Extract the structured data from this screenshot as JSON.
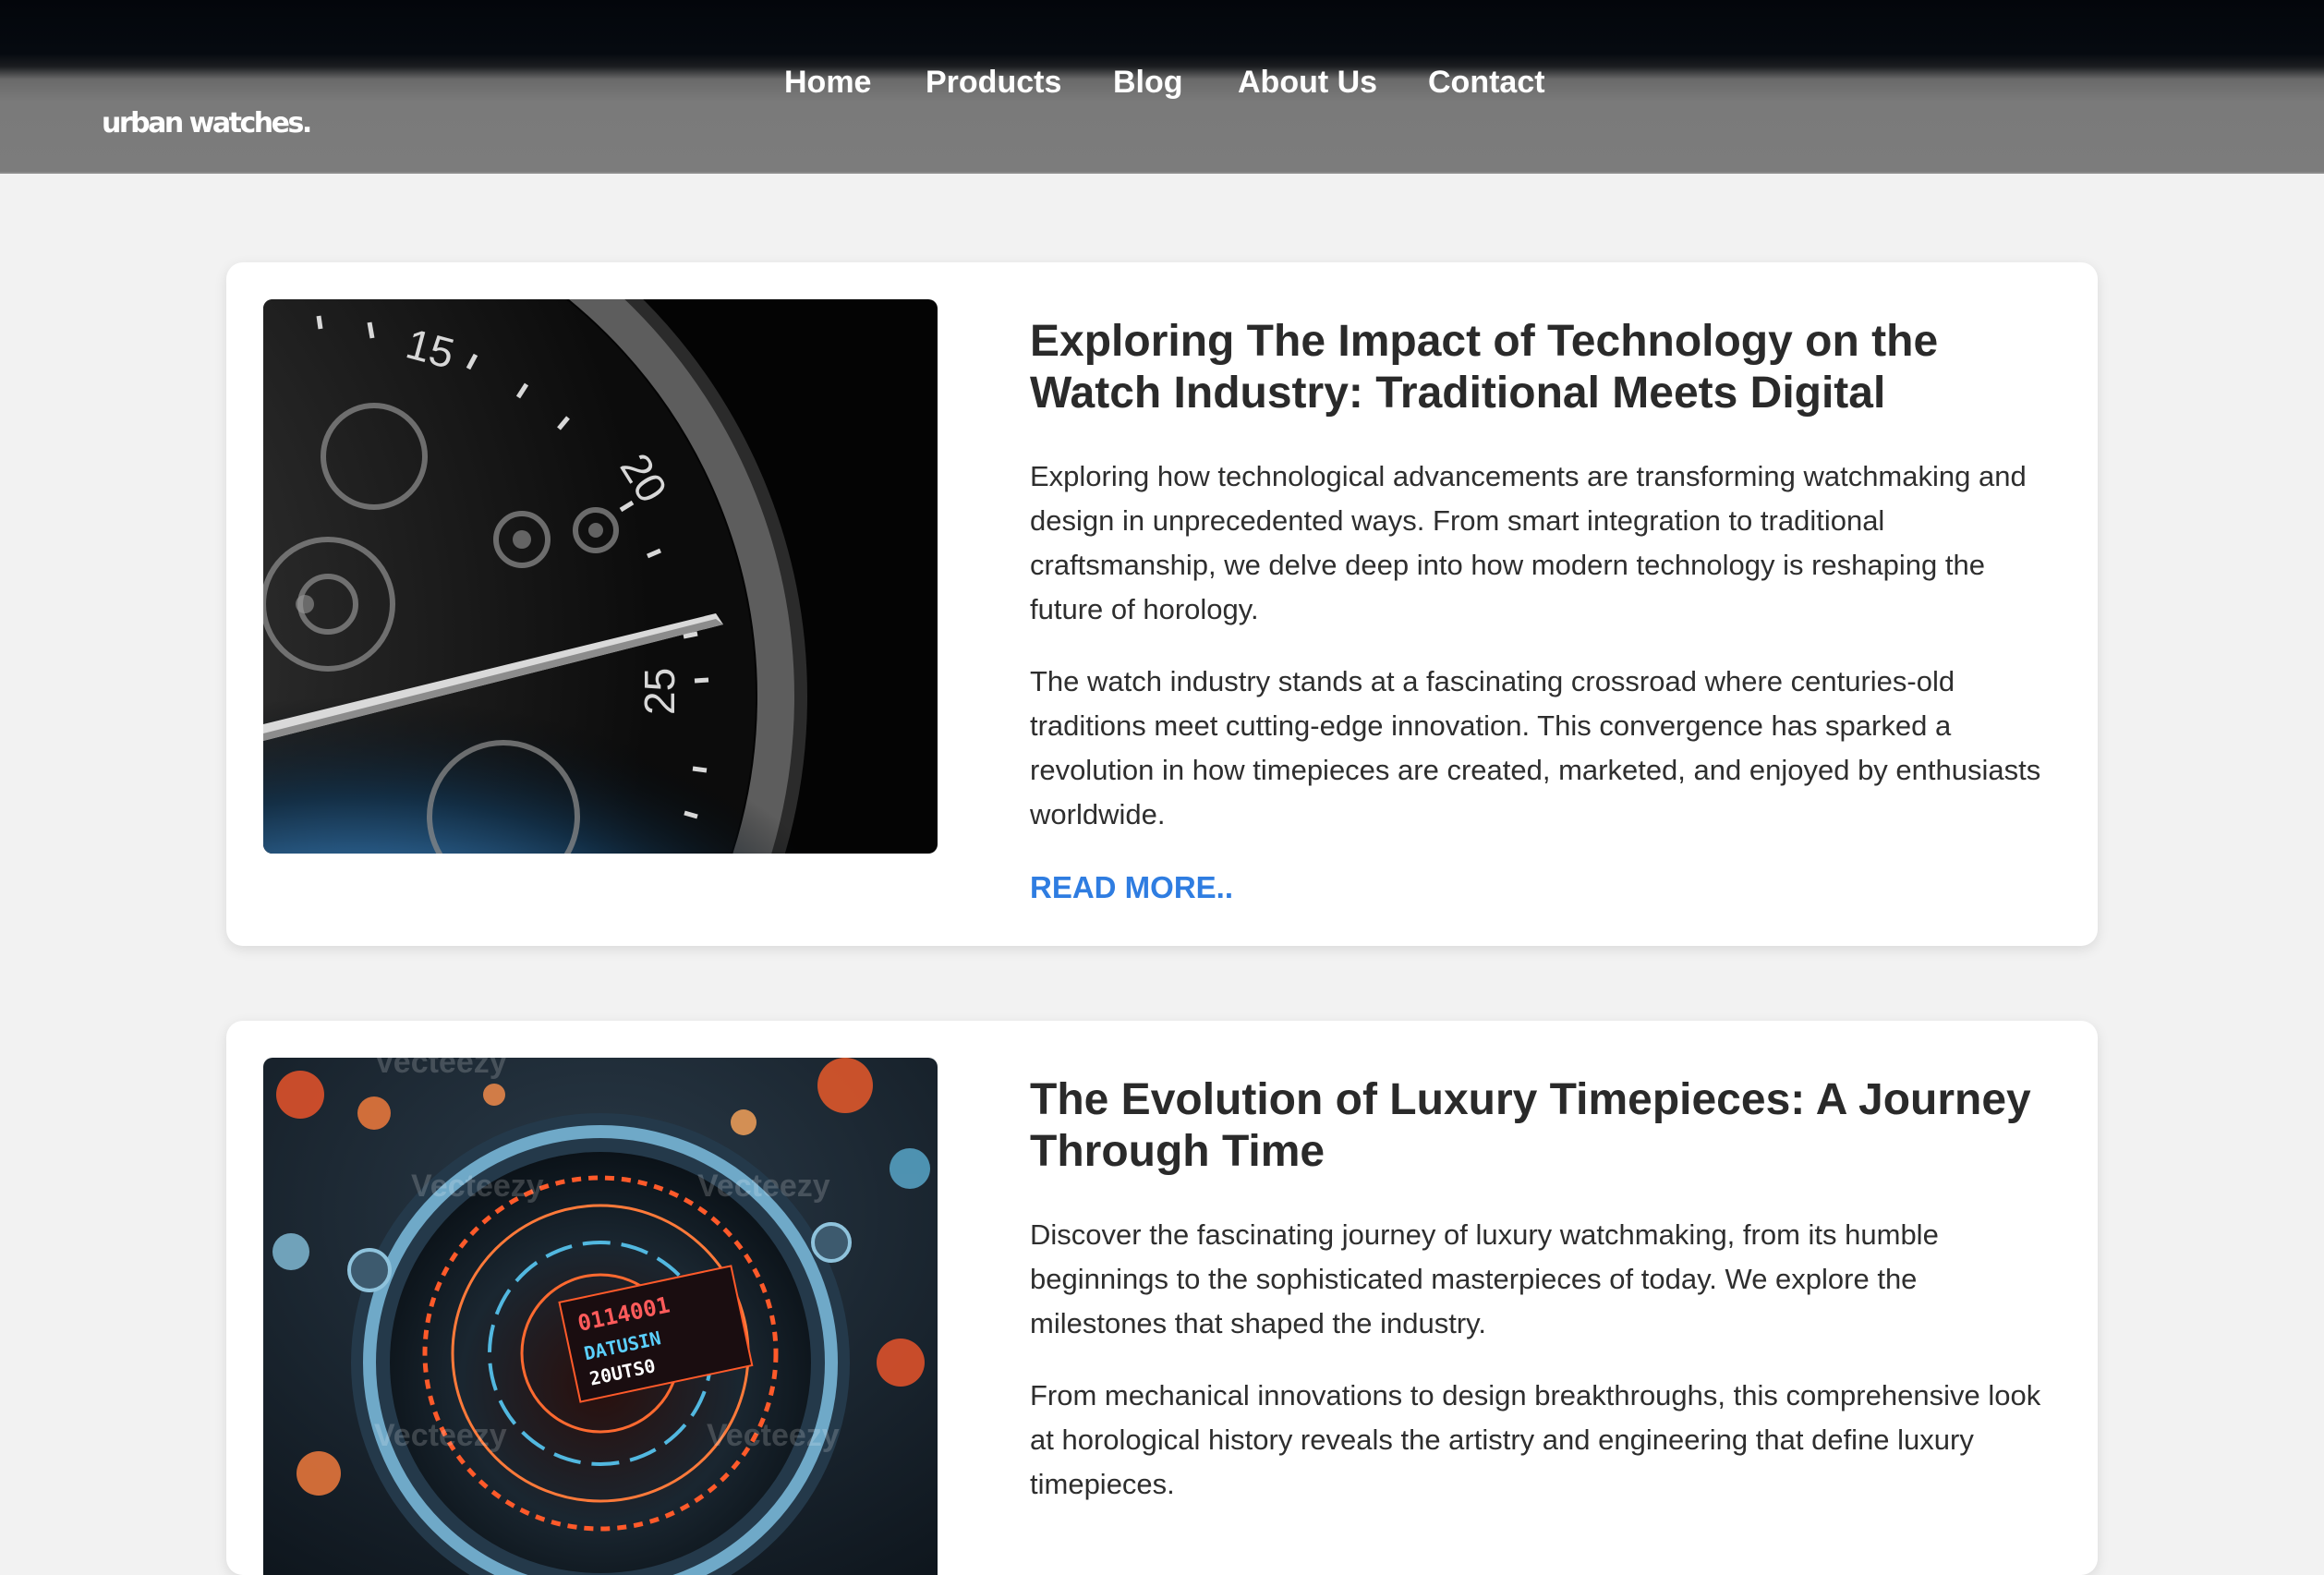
{
  "header": {
    "logo": "urban watches.",
    "nav": [
      {
        "label": "Home"
      },
      {
        "label": "Products"
      },
      {
        "label": "Blog"
      },
      {
        "label": "About Us"
      },
      {
        "label": "Contact"
      }
    ]
  },
  "posts": [
    {
      "title": "Exploring The Impact of Technology on the Watch Industry: Traditional Meets Digital",
      "paragraphs": [
        "Exploring how technological advancements are transforming watchmaking and design in unprecedented ways. From smart integration to traditional craftsmanship, we delve deep into how modern technology is reshaping the future of horology.",
        "The watch industry stands at a fascinating crossroad where centuries-old traditions meet cutting-edge innovation. This convergence has sparked a revolution in how timepieces are created, marketed, and enjoyed by enthusiasts worldwide."
      ],
      "read_more": "READ MORE.."
    },
    {
      "title": "The Evolution of Luxury Timepieces: A Journey Through Time",
      "paragraphs": [
        "Discover the fascinating journey of luxury watchmaking, from its humble beginnings to the sophisticated masterpieces of today. We explore the milestones that shaped the industry.",
        "From mechanical innovations to design breakthroughs, this comprehensive look at horological history reveals the artistry and engineering that define luxury timepieces."
      ]
    }
  ],
  "image_watermark": "Vecteezy"
}
